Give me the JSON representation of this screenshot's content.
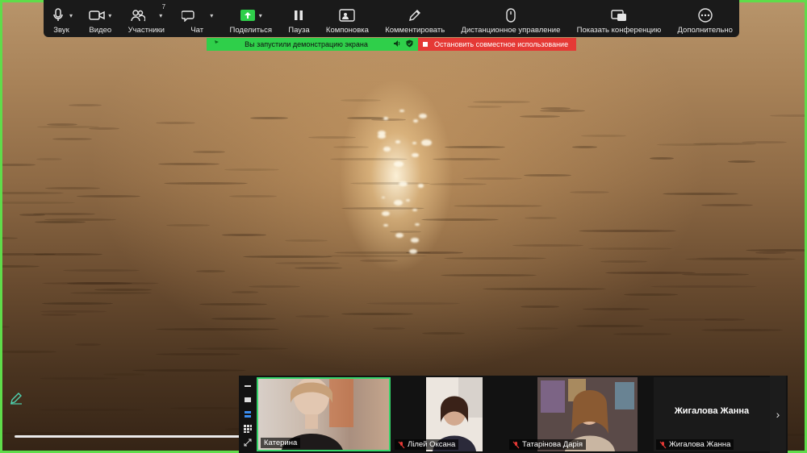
{
  "toolbar": {
    "audio_label": "Звук",
    "video_label": "Видео",
    "participants_label": "Участники",
    "participants_count": "7",
    "chat_label": "Чат",
    "share_label": "Поделиться",
    "pause_label": "Пауза",
    "layout_label": "Компоновка",
    "annotate_label": "Комментировать",
    "remote_control_label": "Дистанционное управление",
    "show_meeting_label": "Показать конференцию",
    "more_label": "Дополнительно"
  },
  "share_banner": {
    "status_text": "Вы запустили демонстрацию экрана",
    "stop_text": "Остановить совместное использование"
  },
  "participants": [
    {
      "name": "Катерина",
      "muted": false
    },
    {
      "name": "Лілей Оксана",
      "muted": true
    },
    {
      "name": "Татарінова Дарія",
      "muted": true
    },
    {
      "name": "Жигалова Жанна",
      "muted": true,
      "video_off_name": "Жигалова Жанна"
    }
  ],
  "colors": {
    "share_border": "#5fdc4a",
    "banner_green": "#2fcf4a",
    "banner_red": "#e53935",
    "toolbar_bg": "#1a1a1a",
    "active_speaker": "#35d46a"
  }
}
